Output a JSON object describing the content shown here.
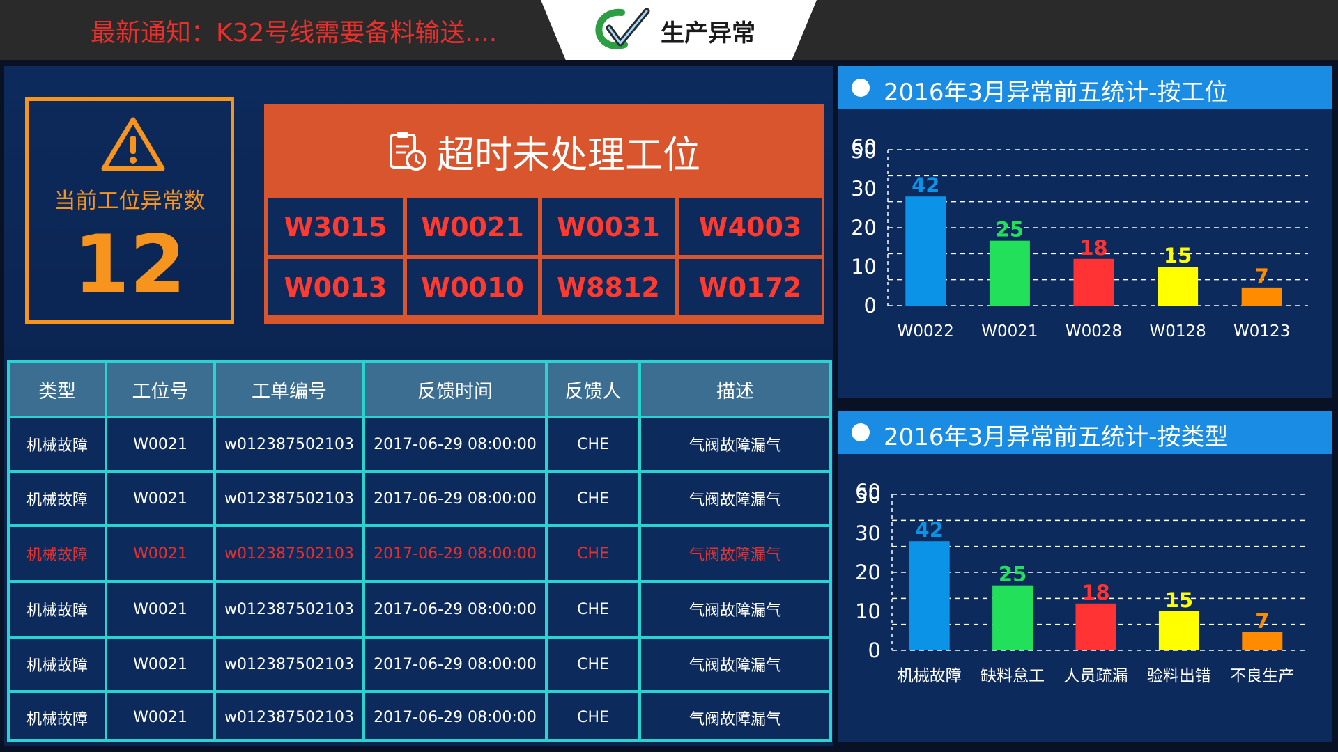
{
  "notice": "最新通知：K32号线需要备料输送....",
  "brand": {
    "title": "生产异常"
  },
  "count_panel": {
    "label": "当前工位异常数",
    "value": "12",
    "icon": "warning-icon"
  },
  "timeout_panel": {
    "title": "超时未处理工位",
    "icon": "clipboard-timer-icon",
    "stations": [
      "W3015",
      "W0021",
      "W0031",
      "W4003",
      "W0013",
      "W0010",
      "W8812",
      "W0172"
    ]
  },
  "table": {
    "headers": [
      "类型",
      "工位号",
      "工单编号",
      "反馈时间",
      "反馈人",
      "描述"
    ],
    "rows": [
      [
        "机械故障",
        "W0021",
        "w012387502103",
        "2017-06-29 08:00:00",
        "CHE",
        "气阀故障漏气"
      ],
      [
        "机械故障",
        "W0021",
        "w012387502103",
        "2017-06-29 08:00:00",
        "CHE",
        "气阀故障漏气"
      ],
      [
        "机械故障",
        "W0021",
        "w012387502103",
        "2017-06-29 08:00:00",
        "CHE",
        "气阀故障漏气"
      ],
      [
        "机械故障",
        "W0021",
        "w012387502103",
        "2017-06-29 08:00:00",
        "CHE",
        "气阀故障漏气"
      ],
      [
        "机械故障",
        "W0021",
        "w012387502103",
        "2017-06-29 08:00:00",
        "CHE",
        "气阀故障漏气"
      ],
      [
        "机械故障",
        "W0021",
        "w012387502103",
        "2017-06-29 08:00:00",
        "CHE",
        "气阀故障漏气"
      ]
    ],
    "highlight_row": 2,
    "colors": {
      "border": "#29d3d0",
      "header_bg": "#3c6e92",
      "highlight_text": "#e8302c"
    }
  },
  "chart_data": [
    {
      "type": "bar",
      "title": "2016年3月异常前五统计-按工位",
      "categories": [
        "W0022",
        "W0021",
        "W0028",
        "W0128",
        "W0123"
      ],
      "values": [
        42,
        25,
        18,
        15,
        7
      ],
      "colors": [
        "#0b93e8",
        "#23e05a",
        "#ff3333",
        "#ffff00",
        "#ff8c00"
      ],
      "ylim": [
        0,
        60
      ],
      "yticks": [
        0,
        10,
        20,
        30,
        40,
        50,
        60
      ],
      "ytick_labels": [
        "0",
        "10",
        "20",
        "30",
        "50",
        "60"
      ],
      "grid": true
    },
    {
      "type": "bar",
      "title": "2016年3月异常前五统计-按类型",
      "categories": [
        "机械故障",
        "缺料怠工",
        "人员疏漏",
        "验料出错",
        "不良生产"
      ],
      "values": [
        42,
        25,
        18,
        15,
        7
      ],
      "colors": [
        "#0b93e8",
        "#23e05a",
        "#ff3333",
        "#ffff00",
        "#ff8c00"
      ],
      "ylim": [
        0,
        60
      ],
      "yticks": [
        0,
        10,
        20,
        30,
        40,
        50,
        60
      ],
      "ytick_labels": [
        "0",
        "10",
        "20",
        "30",
        "50",
        "60"
      ],
      "grid": true
    }
  ]
}
